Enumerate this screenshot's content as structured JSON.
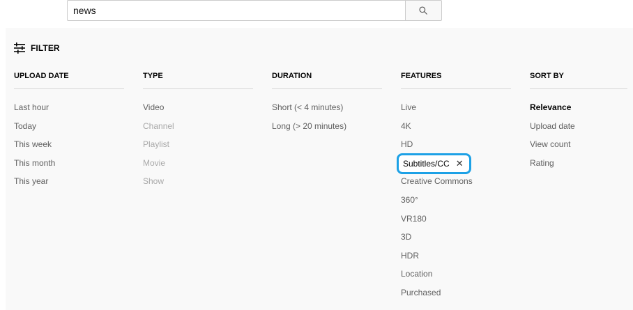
{
  "search": {
    "value": "news",
    "button_icon": "search-icon"
  },
  "filter": {
    "icon": "tune-icon",
    "label": "FILTER"
  },
  "groups": [
    {
      "title": "UPLOAD DATE",
      "items": [
        "Last hour",
        "Today",
        "This week",
        "This month",
        "This year"
      ]
    },
    {
      "title": "TYPE",
      "items": [
        "Video",
        "Channel",
        "Playlist",
        "Movie",
        "Show"
      ]
    },
    {
      "title": "DURATION",
      "items": [
        "Short (< 4 minutes)",
        "Long (> 20 minutes)"
      ]
    },
    {
      "title": "FEATURES",
      "items": [
        "Live",
        "4K",
        "HD",
        "Subtitles/CC",
        "Creative Commons",
        "360°",
        "VR180",
        "3D",
        "HDR",
        "Location",
        "Purchased"
      ],
      "selected_remove_icon": "close-icon"
    },
    {
      "title": "SORT BY",
      "items": [
        "Relevance",
        "Upload date",
        "View count",
        "Rating"
      ]
    }
  ],
  "colors": {
    "panel_bg": "#f9f9f9",
    "highlight_ring": "#1da1e6",
    "divider": "#d6d6d6",
    "text_normal": "#606060",
    "text_disabled": "#a8a8a8"
  }
}
